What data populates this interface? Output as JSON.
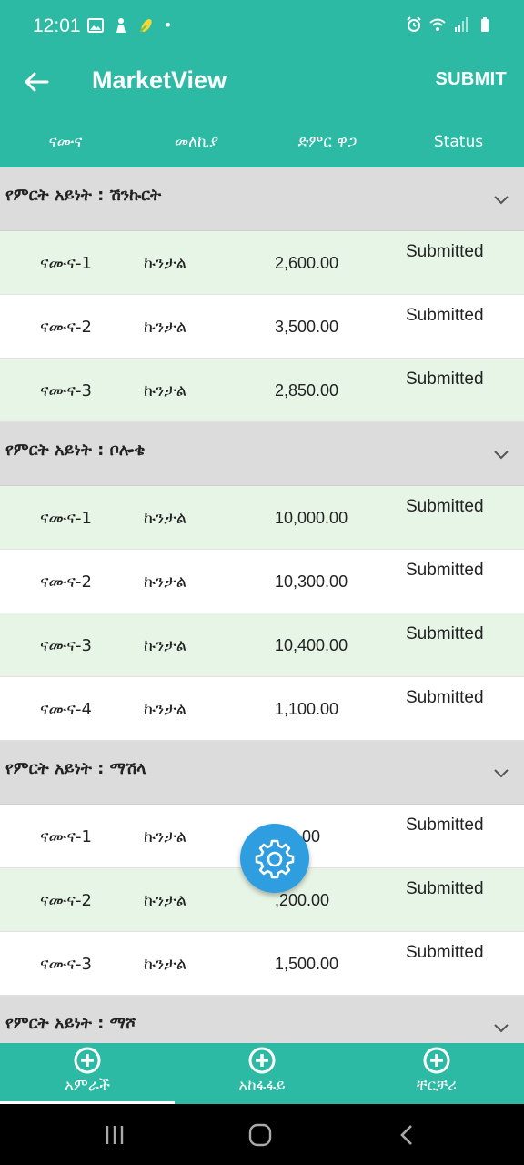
{
  "status_bar": {
    "time": "12:01",
    "dot": "•"
  },
  "app_bar": {
    "title": "MarketView",
    "submit_label": "SUBMIT"
  },
  "columns": {
    "sample": "ናሙና",
    "unit": "መለኪያ",
    "total": "ድምር ዋጋ",
    "status": "Status"
  },
  "groups": [
    {
      "title": "የምርት አይነት : ሽንኩርት",
      "rows": [
        {
          "sample": "ናሙና-1",
          "unit": "ኩንታል",
          "total": "2,600.00",
          "status": "Submitted"
        },
        {
          "sample": "ናሙና-2",
          "unit": "ኩንታል",
          "total": "3,500.00",
          "status": "Submitted"
        },
        {
          "sample": "ናሙና-3",
          "unit": "ኩንታል",
          "total": "2,850.00",
          "status": "Submitted"
        }
      ]
    },
    {
      "title": "የምርት አይነት : ቦሎቄ",
      "rows": [
        {
          "sample": "ናሙና-1",
          "unit": "ኩንታል",
          "total": "10,000.00",
          "status": "Submitted"
        },
        {
          "sample": "ናሙና-2",
          "unit": "ኩንታል",
          "total": "10,300.00",
          "status": "Submitted"
        },
        {
          "sample": "ናሙና-3",
          "unit": "ኩንታል",
          "total": "10,400.00",
          "status": "Submitted"
        },
        {
          "sample": "ናሙና-4",
          "unit": "ኩንታል",
          "total": "1,100.00",
          "status": "Submitted"
        }
      ]
    },
    {
      "title": "የምርት አይነት : ማሽላ",
      "rows": [
        {
          "sample": "ናሙና-1",
          "unit": "ኩንታል",
          "total": ",00.00",
          "status": "Submitted"
        },
        {
          "sample": "ናሙና-2",
          "unit": "ኩንታል",
          "total": ",200.00",
          "status": "Submitted"
        },
        {
          "sample": "ናሙና-3",
          "unit": "ኩንታል",
          "total": "1,500.00",
          "status": "Submitted"
        }
      ]
    },
    {
      "title": "የምርት አይነት : ማሾ",
      "rows": []
    }
  ],
  "bottom_nav": [
    {
      "label": "አምራች",
      "icon": "add-circle-icon",
      "active": true
    },
    {
      "label": "አከፋፋይ",
      "icon": "add-circle-icon",
      "active": false
    },
    {
      "label": "ቸርቻሪ",
      "icon": "add-circle-icon",
      "active": false
    }
  ],
  "fab": {
    "icon": "gear-icon"
  },
  "colors": {
    "primary": "#2cbaa5",
    "row_tint": "#e6f5e6",
    "group_bg": "#dcdcdc",
    "fab": "#2e9ee0"
  }
}
